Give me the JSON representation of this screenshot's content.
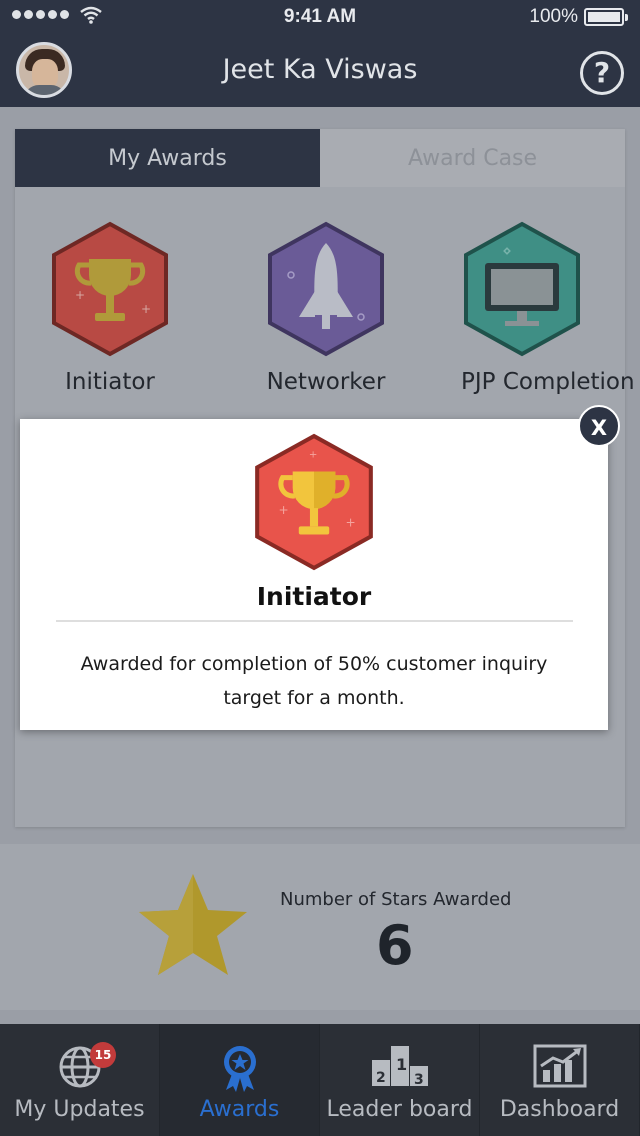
{
  "status_bar": {
    "time": "9:41 AM",
    "battery_percent": "100%",
    "signal_bars": 5
  },
  "header": {
    "user_name": "Jeet Ka Viswas",
    "help_label": "?"
  },
  "tabs": {
    "my_awards": "My Awards",
    "award_case": "Award Case",
    "active": "my_awards"
  },
  "awards": [
    {
      "label": "Initiator",
      "icon": "trophy-icon",
      "color": "#b84a44"
    },
    {
      "label": "Networker",
      "icon": "rocket-icon",
      "color": "#6a5b97"
    },
    {
      "label": "PJP Completion",
      "icon": "monitor-icon",
      "color": "#3f8f85"
    }
  ],
  "stars": {
    "label": "Number of Stars Awarded",
    "count": "6"
  },
  "bottom_nav": [
    {
      "label": "My Updates",
      "icon": "globe-icon",
      "badge": "15"
    },
    {
      "label": "Awards",
      "icon": "award-icon",
      "active": true
    },
    {
      "label": "Leader board",
      "icon": "podium-icon"
    },
    {
      "label": "Dashboard",
      "icon": "chart-icon"
    }
  ],
  "modal": {
    "title": "Initiator",
    "description": "Awarded for completion of 50% customer inquiry target for a month.",
    "close_label": "X",
    "icon": "trophy-icon",
    "accent_color": "#e8544b"
  }
}
